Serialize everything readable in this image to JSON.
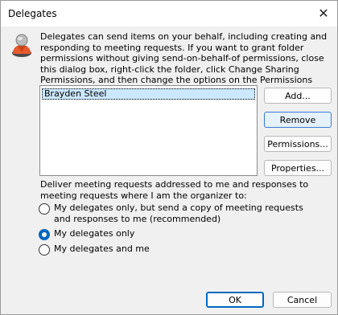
{
  "window": {
    "title": "Delegates",
    "close_glyph": "✕"
  },
  "description": "Delegates can send items on your behalf, including creating and responding to meeting requests. If you want to grant folder permissions without giving send-on-behalf-of permissions, close this dialog box, right-click the folder, click Change Sharing Permissions, and then change the options on the Permissions tab.",
  "delegates": [
    "Brayden Steel"
  ],
  "buttons": {
    "add": "Add...",
    "remove": "Remove",
    "permissions": "Permissions...",
    "properties": "Properties...",
    "ok": "OK",
    "cancel": "Cancel"
  },
  "deliver_label": "Deliver meeting requests addressed to me and responses to meeting requests where I am the organizer to:",
  "options": [
    {
      "label": "My delegates only, but send a copy of meeting requests and responses to me (recommended)",
      "checked": false
    },
    {
      "label": "My delegates only",
      "checked": true
    },
    {
      "label": "My delegates and me",
      "checked": false
    }
  ]
}
